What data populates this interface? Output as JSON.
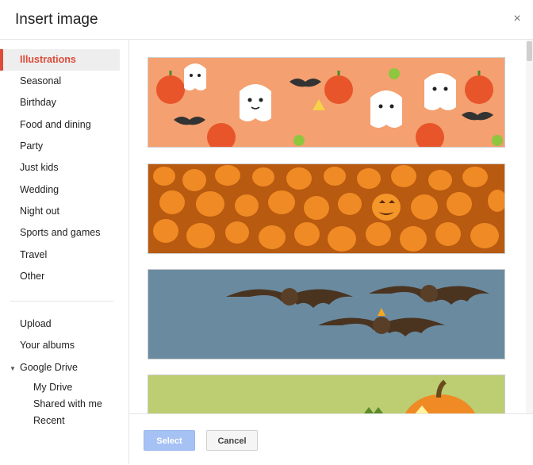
{
  "dialog": {
    "title": "Insert image",
    "close_glyph": "×"
  },
  "sidebar": {
    "categories": [
      {
        "label": "Illustrations",
        "active": true
      },
      {
        "label": "Seasonal"
      },
      {
        "label": "Birthday"
      },
      {
        "label": "Food and dining"
      },
      {
        "label": "Party"
      },
      {
        "label": "Just kids"
      },
      {
        "label": "Wedding"
      },
      {
        "label": "Night out"
      },
      {
        "label": "Sports and games"
      },
      {
        "label": "Travel"
      },
      {
        "label": "Other"
      }
    ],
    "sources": [
      {
        "label": "Upload"
      },
      {
        "label": "Your albums"
      },
      {
        "label": "Google Drive"
      }
    ],
    "drive_items": [
      {
        "label": "My Drive"
      },
      {
        "label": "Shared with me"
      },
      {
        "label": "Recent"
      }
    ],
    "accent_color": "#dd4b39"
  },
  "images": [
    {
      "name": "halloween-ghosts-pumpkins",
      "bg": "#f4a070"
    },
    {
      "name": "pumpkin-patch",
      "bg": "#b85a10"
    },
    {
      "name": "bats-blue-sky",
      "bg": "#6a8aa0"
    },
    {
      "name": "pumpkin-green",
      "bg": "#bccd72"
    }
  ],
  "footer": {
    "select_label": "Select",
    "cancel_label": "Cancel"
  }
}
